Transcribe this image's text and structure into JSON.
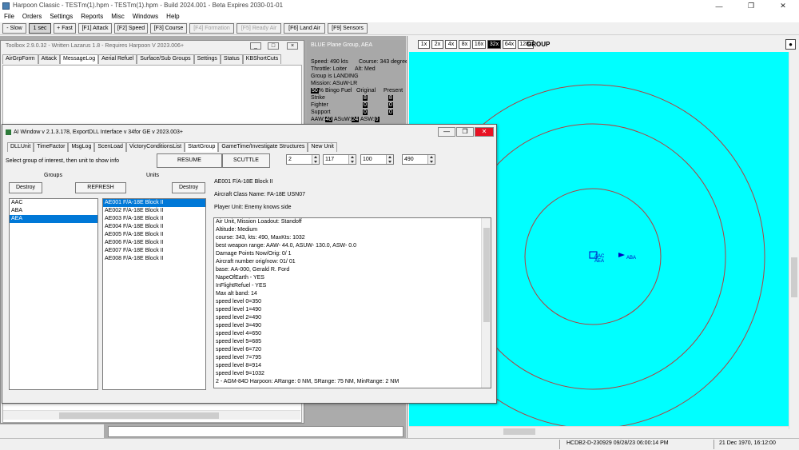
{
  "app": {
    "title": "Harpoon Classic - TESTm(1).hpm - TESTm(1).hpm - Build 2024.001 - Beta Expires 2030-01-01",
    "window_controls": [
      "—",
      "❐",
      "✕"
    ]
  },
  "menu": [
    "File",
    "Orders",
    "Settings",
    "Reports",
    "Misc",
    "Windows",
    "Help"
  ],
  "toolbar": [
    {
      "label": "- Slow",
      "state": "normal"
    },
    {
      "label": "1 sec",
      "state": "pressed"
    },
    {
      "label": "+ Fast",
      "state": "normal"
    },
    {
      "label": "[F1] Attack",
      "state": "normal"
    },
    {
      "label": "[F2] Speed",
      "state": "normal"
    },
    {
      "label": "[F3] Course",
      "state": "normal"
    },
    {
      "label": "[F4] Formation",
      "state": "disabled"
    },
    {
      "label": "[F5] Ready Air",
      "state": "disabled"
    },
    {
      "label": "[F6] Land Air",
      "state": "normal"
    },
    {
      "label": "[F9] Sensors",
      "state": "normal"
    }
  ],
  "toolbox": {
    "title": "Toolbox 2.9.0.32 - Written Lazarus 1.8 - Requires Harpoon V 2023.006+",
    "tabs": [
      "AirGrpForm",
      "Attack",
      "MessageLog",
      "Aerial Refuel",
      "Surface/Sub Groups",
      "Settings",
      "Status",
      "KBShortCuts"
    ],
    "active_tab": 2
  },
  "group_panel": {
    "title": "BLUE Plane Group, AEA",
    "speed": "Speed: 490 kts",
    "course": "Course: 343 degrees",
    "throttle": "Throttle: Loiter",
    "alt": "Alt: Med",
    "group_state": "Group is LANDING",
    "mission": "Mission: ASuW-LR",
    "bingo_pct": "50",
    "bingo_label": "% Bingo Fuel",
    "col_original": "Original",
    "col_present": "Present",
    "rows": [
      {
        "name": "Strike",
        "original": "8",
        "present": "8"
      },
      {
        "name": "Fighter",
        "original": "0",
        "present": "0"
      },
      {
        "name": "Support",
        "original": "0",
        "present": "0"
      }
    ],
    "aaw_label": "AAW:",
    "aaw": "40",
    "asuw_label": "ASuW:",
    "asuw": "24",
    "asw_label": "ASW:",
    "asw": "0"
  },
  "map": {
    "zoom_buttons": [
      "1x",
      "2x",
      "4x",
      "8x",
      "16x",
      "32x",
      "64x",
      "128x"
    ],
    "selected_zoom": "32x",
    "label": "GROUP",
    "close_glyph": "●",
    "bg_color": "#00ffff",
    "ring_color": "#b04040",
    "units": [
      {
        "name": "AAC"
      },
      {
        "name": "ABA"
      },
      {
        "name": "AEA"
      }
    ]
  },
  "ai": {
    "title": "AI Window v 2.1.3.178, ExportDLL Interface v 34for GE v 2023.003+",
    "tabs": [
      "DLLUnit",
      "TimeFactor",
      "MsgLog",
      "ScenLoad",
      "VictoryConditionsList",
      "StartGroup",
      "GameTime/Investigate Structures",
      "New Unit"
    ],
    "active_tab": 5,
    "instructions": "Select group of interest, then unit to show info",
    "resume_label": "RESUME",
    "scuttle_label": "SCUTTLE",
    "spinners": [
      "2",
      "117",
      "100",
      "490"
    ],
    "groups_label": "Groups",
    "units_label": "Units",
    "destroy_label": "Destroy",
    "refresh_label": "REFRESH",
    "groups": [
      "AAC",
      "ABA",
      "AEA"
    ],
    "selected_group": 2,
    "units": [
      "AE001 F/A-18E Block II",
      "AE002 F/A-18E Block II",
      "AE003 F/A-18E Block II",
      "AE004 F/A-18E Block II",
      "AE005 F/A-18E Block II",
      "AE006 F/A-18E Block II",
      "AE007 F/A-18E Block II",
      "AE008 F/A-18E Block II"
    ],
    "selected_unit": 0,
    "unit_name": "AE001 F/A-18E Block II",
    "aircraft_class": "Aircraft Class Name: FA-18E USN07",
    "player_unit": "Player Unit: Enemy knows side",
    "info_lines": [
      "Air Unit, Mission Loadout: Standoff",
      "Altitude: Medium",
      "course: 343, kts: 490, MaxKts: 1032",
      "best weapon range: AAW- 44.0, ASUW- 130.0, ASW- 0.0",
      "Damage Points Now/Orig: 0/ 1",
      "Aircraft number orig/now: 01/ 01",
      "base: AA-000, Gerald R. Ford",
      "NapeOfEarth - YES",
      "InFlightRefuel - YES",
      "Max alt band: 14",
      "speed level 0=350",
      "speed level 1=490",
      "speed level 2=490",
      "speed level 3=490",
      "speed level 4=650",
      "speed level 5=685",
      "speed level 6=720",
      "speed level 7=795",
      "speed level 8=914",
      "speed level 9=1032",
      "2 - AGM-84D Harpoon: ARange: 0 NM, SRange: 75 NM, MinRange: 2 NM"
    ]
  },
  "status": {
    "build": "HCDB2-D-230929 09/28/23 06:00:14 PM",
    "date": "21 Dec 1970, 16:12:00"
  }
}
